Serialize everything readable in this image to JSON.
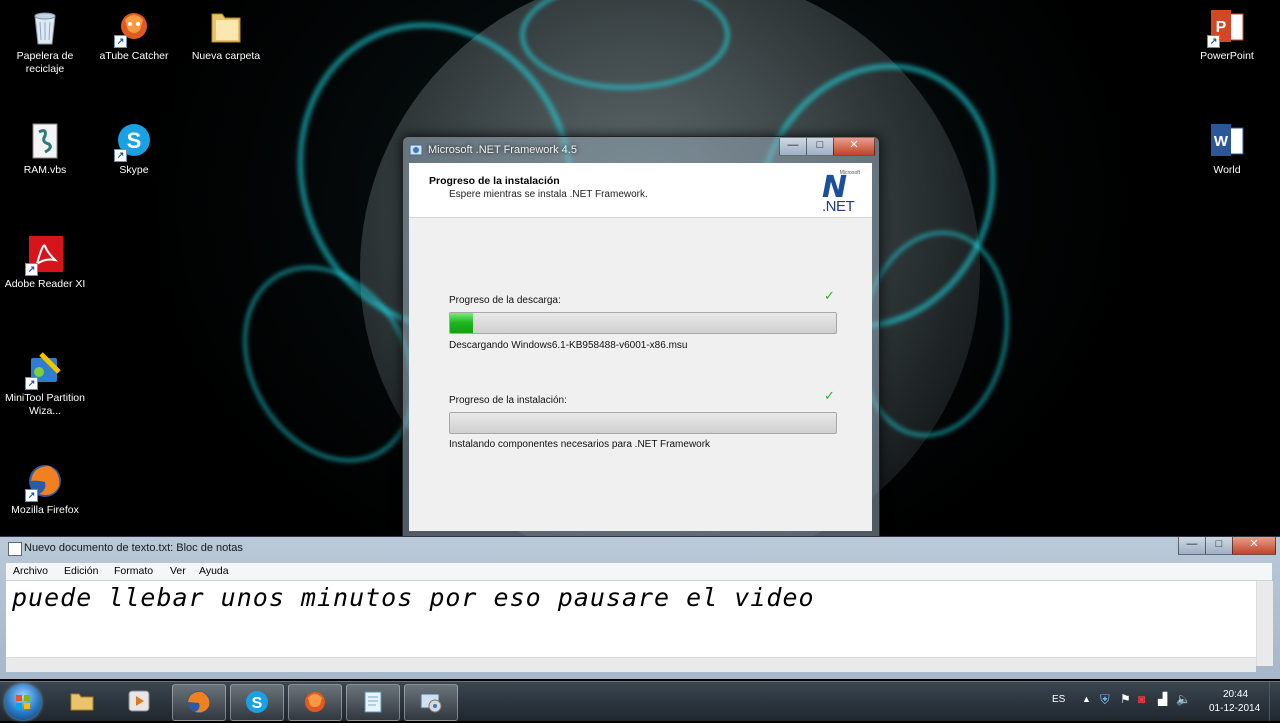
{
  "desktop": {
    "icons_left": [
      {
        "label": "Papelera de reciclaje",
        "icon": "recycle-bin-icon"
      },
      {
        "label": "aTube Catcher",
        "icon": "atube-catcher-icon"
      },
      {
        "label": "Nueva carpeta",
        "icon": "folder-icon"
      },
      {
        "label": "RAM.vbs",
        "icon": "vbs-script-icon"
      },
      {
        "label": "Skype",
        "icon": "skype-icon"
      },
      {
        "label": "Adobe Reader XI",
        "icon": "adobe-reader-icon"
      },
      {
        "label": "MiniTool Partition Wiza...",
        "icon": "minitool-icon"
      },
      {
        "label": "Mozilla Firefox",
        "icon": "firefox-icon"
      }
    ],
    "icons_right": [
      {
        "label": "PowerPoint",
        "icon": "powerpoint-icon"
      },
      {
        "label": "World",
        "icon": "word-icon"
      }
    ]
  },
  "installer": {
    "title": "Microsoft .NET Framework 4.5",
    "header_title": "Progreso de la instalación",
    "header_subtitle": "Espere mientras se instala .NET Framework.",
    "logo_small": "Microsoft",
    "logo_text": ".NET",
    "download": {
      "label": "Progreso de la descarga:",
      "progress": 0.06,
      "status": "Descargando Windows6.1-KB958488-v6001-x86.msu"
    },
    "install": {
      "label": "Progreso de la instalación:",
      "progress": 0.0,
      "status": "Instalando componentes necesarios para .NET Framework"
    },
    "buttons": {
      "minimize": "—",
      "maximize": "□",
      "close": "✕"
    }
  },
  "notepad": {
    "title": "Nuevo documento de texto.txt: Bloc de notas",
    "menu": [
      "Archivo",
      "Edición",
      "Formato",
      "Ver",
      "Ayuda"
    ],
    "content": "puede llebar unos minutos por eso pausare el video"
  },
  "taskbar": {
    "apps": [
      "explorer",
      "media-player",
      "firefox",
      "skype",
      "atube-catcher",
      "notepad",
      "installer"
    ],
    "tray": {
      "language": "ES",
      "time": "20:44",
      "date": "01-12-2014"
    }
  }
}
